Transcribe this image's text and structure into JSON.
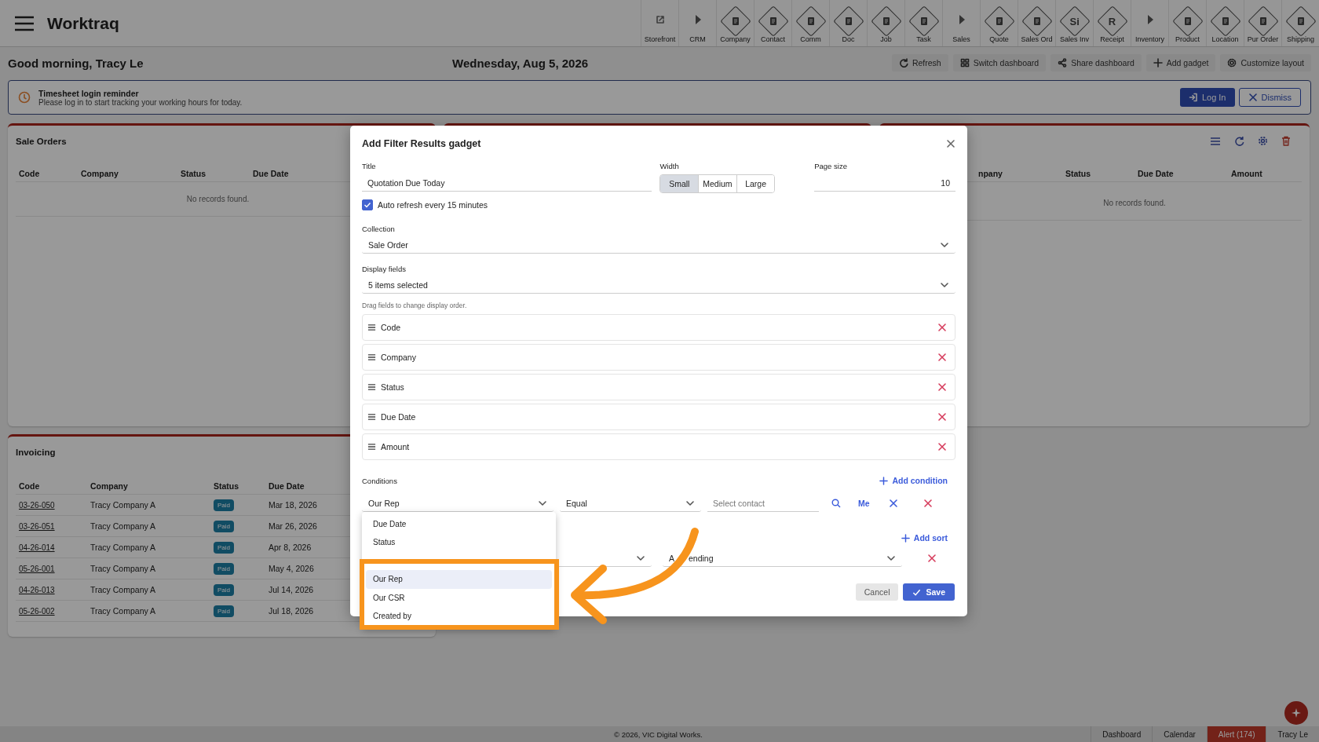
{
  "app": {
    "title": "Worktraq"
  },
  "toolbar": [
    {
      "label": "Storefront",
      "kind": "link"
    },
    {
      "label": "CRM",
      "kind": "section"
    },
    {
      "label": "Company",
      "kind": "module"
    },
    {
      "label": "Contact",
      "kind": "module"
    },
    {
      "label": "Comm",
      "kind": "module"
    },
    {
      "label": "Doc",
      "kind": "module"
    },
    {
      "label": "Job",
      "kind": "module"
    },
    {
      "label": "Task",
      "kind": "module"
    },
    {
      "label": "Sales",
      "kind": "section"
    },
    {
      "label": "Quote",
      "kind": "module"
    },
    {
      "label": "Sales Ord",
      "kind": "module"
    },
    {
      "label": "Sales Inv",
      "kind": "module",
      "glyph": "Si"
    },
    {
      "label": "Receipt",
      "kind": "module",
      "glyph": "R"
    },
    {
      "label": "Inventory",
      "kind": "section"
    },
    {
      "label": "Product",
      "kind": "module"
    },
    {
      "label": "Location",
      "kind": "module"
    },
    {
      "label": "Pur Order",
      "kind": "module"
    },
    {
      "label": "Shipping",
      "kind": "module"
    }
  ],
  "header": {
    "greeting": "Good morning, Tracy Le",
    "date": "Wednesday, Aug 5, 2026",
    "actions": [
      {
        "label": "Refresh",
        "kind": "refresh"
      },
      {
        "label": "Switch dashboard",
        "kind": "grid"
      },
      {
        "label": "Share dashboard",
        "kind": "share"
      },
      {
        "label": "Add gadget",
        "kind": "add"
      },
      {
        "label": "Customize layout",
        "kind": "gear"
      }
    ]
  },
  "reminder": {
    "title": "Timesheet login reminder",
    "message": "Please log in to start tracking your working hours for today.",
    "login": "Log In",
    "dismiss": "Dismiss"
  },
  "sale_orders": {
    "title": "Sale Orders",
    "columns": [
      "Code",
      "Company",
      "Status",
      "Due Date"
    ],
    "empty": "No records found."
  },
  "right_gadget": {
    "columns": [
      "npany",
      "Status",
      "Due Date",
      "Amount"
    ],
    "empty": "No records found."
  },
  "invoicing": {
    "title": "Invoicing",
    "columns": [
      "Code",
      "Company",
      "Status",
      "Due Date"
    ],
    "rows": [
      {
        "code": "03-26-050",
        "company": "Tracy Company A",
        "status": "Paid",
        "due": "Mar 18, 2026"
      },
      {
        "code": "03-26-051",
        "company": "Tracy Company A",
        "status": "Paid",
        "due": "Mar 26, 2026"
      },
      {
        "code": "04-26-014",
        "company": "Tracy Company A",
        "status": "Paid",
        "due": "Apr 8, 2026"
      },
      {
        "code": "05-26-001",
        "company": "Tracy Company A",
        "status": "Paid",
        "due": "May 4, 2026"
      },
      {
        "code": "04-26-013",
        "company": "Tracy Company A",
        "status": "Paid",
        "due": "Jul 14, 2026"
      },
      {
        "code": "05-26-002",
        "company": "Tracy Company A",
        "status": "Paid",
        "due": "Jul 18, 2026"
      }
    ]
  },
  "dialog": {
    "title": "Add Filter Results gadget",
    "title_field": {
      "label": "Title",
      "value": "Quotation Due Today"
    },
    "width": {
      "label": "Width",
      "options": [
        {
          "label": "Small",
          "selected": true
        },
        {
          "label": "Medium",
          "selected": false
        },
        {
          "label": "Large",
          "selected": false
        }
      ]
    },
    "page_size": {
      "label": "Page size",
      "value": "10"
    },
    "auto_refresh": {
      "label": "Auto refresh every 15 minutes",
      "checked": true
    },
    "collection": {
      "label": "Collection",
      "value": "Sale Order"
    },
    "display_fields": {
      "label": "Display fields",
      "value": "5 items selected",
      "hint": "Drag fields to change display order.",
      "items": [
        "Code",
        "Company",
        "Status",
        "Due Date",
        "Amount"
      ]
    },
    "conditions": {
      "label": "Conditions",
      "add": "Add condition",
      "field": "Our Rep",
      "operator": "Equal",
      "contact_placeholder": "Select contact",
      "me": "Me"
    },
    "field_options": [
      {
        "label": "Due Date",
        "selected": false
      },
      {
        "label": "Status",
        "selected": false
      },
      {
        "label": "Our Rep",
        "selected": true
      },
      {
        "label": "Our CSR",
        "selected": false
      },
      {
        "label": "Created by",
        "selected": false
      }
    ],
    "sort": {
      "add": "Add sort",
      "direction_parts": [
        "A",
        "ending"
      ]
    },
    "cancel": "Cancel",
    "save": "Save"
  },
  "footer": {
    "copyright": "© 2026, VIC Digital Works.",
    "tabs": [
      {
        "label": "Dashboard",
        "kind": "tab"
      },
      {
        "label": "Calendar",
        "kind": "tab"
      },
      {
        "label": "Alert (174)",
        "kind": "alert"
      },
      {
        "label": "Tracy Le",
        "kind": "user"
      }
    ]
  }
}
